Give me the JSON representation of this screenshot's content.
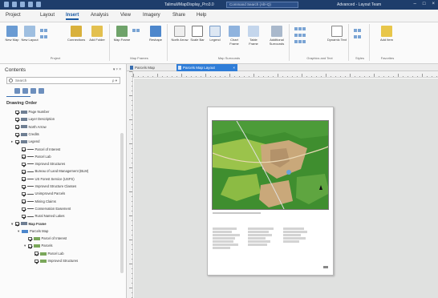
{
  "titlebar": {
    "document_title": "Talimuli/MapDisplay_Pro3.0",
    "search_placeholder": "Command Search (Alt+Q)",
    "context_label": "Advanced - Layout Team"
  },
  "ribbon_tabs": [
    "Project",
    "Layout",
    "Insert",
    "Analysis",
    "View",
    "Imagery",
    "Share",
    "Help"
  ],
  "active_tab": "Insert",
  "ribbon": {
    "groups": [
      {
        "name": "Project",
        "buttons": [
          "New Map",
          "New Layout",
          "Connections",
          "Add Folder"
        ]
      },
      {
        "name": "Map Frames",
        "buttons": [
          "Map Frame",
          "Reshape"
        ]
      },
      {
        "name": "Map Surrounds",
        "buttons": [
          "North Arrow",
          "Scale Bar",
          "Legend",
          "Chart Frame",
          "Table Frame",
          "Additional Surrounds"
        ]
      },
      {
        "name": "Graphics and Text",
        "buttons": [
          "Dynamic Text"
        ]
      },
      {
        "name": "Styles",
        "buttons": []
      },
      {
        "name": "Favorites",
        "buttons": [
          "Add Item"
        ]
      }
    ]
  },
  "contents": {
    "title": "Contents",
    "search_placeholder": "Search",
    "section": "Drawing Order",
    "items": [
      {
        "label": "Page Number",
        "level": 0,
        "expand": "",
        "checked": true,
        "bold": false,
        "icon": "text"
      },
      {
        "label": "Layer Description",
        "level": 0,
        "expand": "",
        "checked": true,
        "bold": false,
        "icon": "text"
      },
      {
        "label": "North Arrow",
        "level": 0,
        "expand": "",
        "checked": true,
        "bold": false,
        "icon": "arrow"
      },
      {
        "label": "Credits",
        "level": 0,
        "expand": "",
        "checked": true,
        "bold": false,
        "icon": "text"
      },
      {
        "label": "Legend",
        "level": 0,
        "expand": "▸",
        "checked": true,
        "bold": false,
        "icon": "legend"
      },
      {
        "label": "Parcel of Interest",
        "level": 1,
        "expand": "",
        "checked": true,
        "bold": false,
        "icon": "line"
      },
      {
        "label": "Parcel Lab",
        "level": 1,
        "expand": "",
        "checked": true,
        "bold": false,
        "icon": "line"
      },
      {
        "label": "Improved Structures",
        "level": 1,
        "expand": "",
        "checked": true,
        "bold": false,
        "icon": "line"
      },
      {
        "label": "Bureau of Land Management (BLM)",
        "level": 1,
        "expand": "",
        "checked": true,
        "bold": false,
        "icon": "line"
      },
      {
        "label": "US Forest Service (USFS)",
        "level": 1,
        "expand": "",
        "checked": true,
        "bold": false,
        "icon": "line"
      },
      {
        "label": "Improved Structure Classes",
        "level": 1,
        "expand": "",
        "checked": true,
        "bold": false,
        "icon": "line"
      },
      {
        "label": "Unimproved Parcels",
        "level": 1,
        "expand": "",
        "checked": true,
        "bold": false,
        "icon": "line"
      },
      {
        "label": "Mining Claims",
        "level": 1,
        "expand": "",
        "checked": true,
        "bold": false,
        "icon": "line"
      },
      {
        "label": "Conservation Easement",
        "level": 1,
        "expand": "",
        "checked": true,
        "bold": false,
        "icon": "line"
      },
      {
        "label": "Rural Named Lakes",
        "level": 1,
        "expand": "",
        "checked": true,
        "bold": false,
        "icon": "line"
      },
      {
        "label": "Map Frame",
        "level": 0,
        "expand": "▾",
        "checked": true,
        "bold": true,
        "icon": "frame"
      },
      {
        "label": "Parcels Map",
        "level": 1,
        "expand": "▾",
        "checked": false,
        "bold": false,
        "icon": "map"
      },
      {
        "label": "Parcel of Interest",
        "level": 2,
        "expand": "",
        "checked": true,
        "bold": false,
        "icon": "poly"
      },
      {
        "label": "Parcels",
        "level": 2,
        "expand": "▾",
        "checked": true,
        "bold": false,
        "icon": "poly"
      },
      {
        "label": "Parcel Lab",
        "level": 3,
        "expand": "",
        "checked": true,
        "bold": false,
        "icon": "poly"
      },
      {
        "label": "Improved Structures",
        "level": 3,
        "expand": "",
        "checked": true,
        "bold": false,
        "icon": "poly"
      }
    ]
  },
  "view_tabs": [
    {
      "label": "Parcels Map",
      "active": false
    },
    {
      "label": "Parcels Map Layout",
      "active": true
    }
  ],
  "layout": {
    "legend_columns": 4,
    "colors": {
      "forest": "#3f8e2f",
      "tan": "#c9a87a",
      "light_green": "#9bc34b",
      "lake": "#6aa2d8",
      "accent": "#2f7dd8"
    }
  }
}
